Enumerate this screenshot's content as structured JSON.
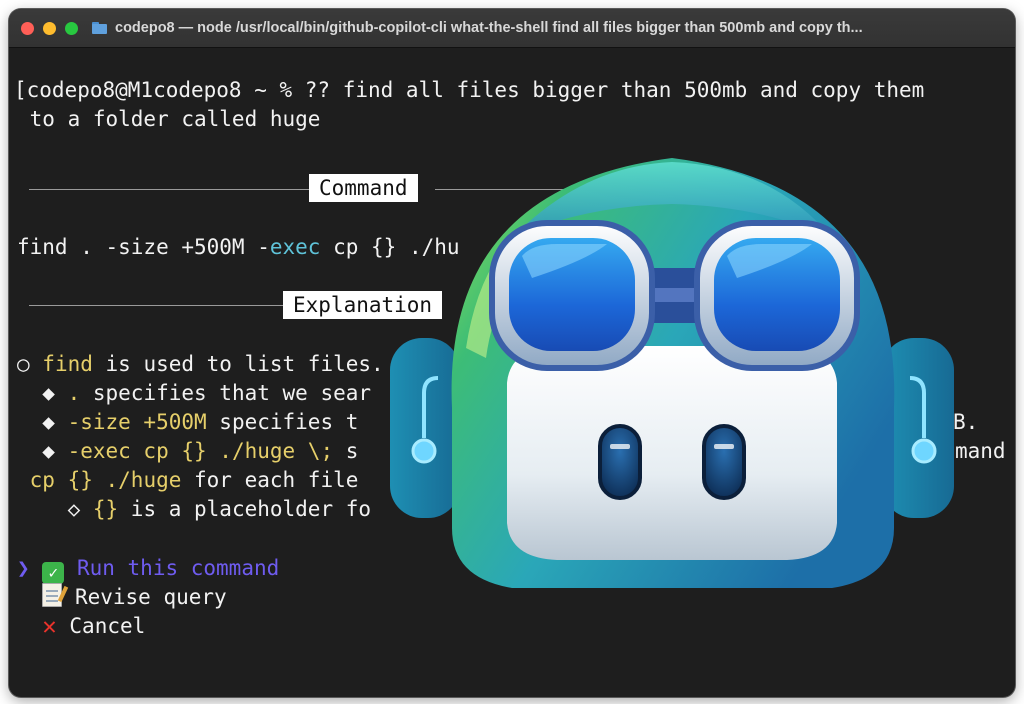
{
  "window": {
    "title": "codepo8 — node /usr/local/bin/github-copilot-cli what-the-shell find all files bigger than 500mb and copy th..."
  },
  "terminal": {
    "prompt_line_1": "[codepo8@M1codepo8 ~ % ?? find all files bigger than 500mb and copy them",
    "prompt_line_2": " to a folder called huge",
    "command_header": "Command",
    "command": {
      "part1": "find . -size +500M -",
      "part2": "exec",
      "part3": " cp {} ./hu"
    },
    "explanation_header": "Explanation",
    "explanation": [
      {
        "bullet": "○ ",
        "highlight": "find",
        "text": " is used to list files."
      },
      {
        "bullet": "  ◆ ",
        "highlight": ".",
        "text": " specifies that we sear"
      },
      {
        "bullet": "  ◆ ",
        "highlight": "-size +500M",
        "text": " specifies t",
        "tail": "B."
      },
      {
        "bullet": "  ◆ ",
        "highlight": "-exec cp {} ./huge \\;",
        "text": " s",
        "tail": "mand"
      },
      {
        "bullet": " ",
        "highlight": "cp {} ./huge",
        "text": " for each file"
      },
      {
        "bullet": "    ◇ ",
        "highlight": "{}",
        "text": " is a placeholder fo"
      }
    ],
    "menu": {
      "pointer": "❯",
      "run_label": "Run this command",
      "revise_label": "Revise query",
      "cancel_label": "Cancel"
    }
  },
  "colors": {
    "terminal_bg": "#1e1e1e",
    "highlight_yellow": "#e6cf6a",
    "keyword_cyan": "#5fc3d9",
    "selection_purple": "#6f5cf0"
  },
  "icons": {
    "run": "check-mark-button-icon",
    "revise": "memo-icon",
    "cancel": "cross-mark-icon",
    "mascot": "github-copilot-mascot-icon"
  }
}
